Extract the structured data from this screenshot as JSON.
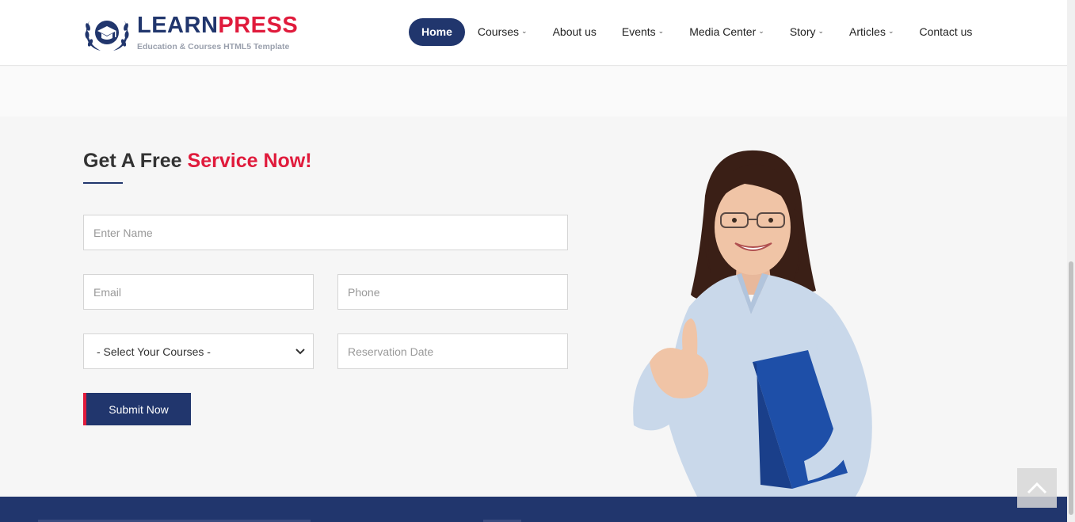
{
  "brand": {
    "name_part1": "LEARN",
    "name_part2": "PRESS",
    "tagline": "Education & Courses HTML5 Template"
  },
  "nav": {
    "items": [
      {
        "label": "Home",
        "active": true,
        "dropdown": false
      },
      {
        "label": "Courses",
        "active": false,
        "dropdown": true
      },
      {
        "label": "About us",
        "active": false,
        "dropdown": false
      },
      {
        "label": "Events",
        "active": false,
        "dropdown": true
      },
      {
        "label": "Media Center",
        "active": false,
        "dropdown": true
      },
      {
        "label": "Story",
        "active": false,
        "dropdown": true
      },
      {
        "label": "Articles",
        "active": false,
        "dropdown": true
      },
      {
        "label": "Contact us",
        "active": false,
        "dropdown": false
      }
    ]
  },
  "section": {
    "heading_part1": "Get A Free",
    "heading_accent": "Service Now!"
  },
  "form": {
    "name_placeholder": "Enter Name",
    "email_placeholder": "Email",
    "phone_placeholder": "Phone",
    "course_select_value": "- Select Your Courses -",
    "date_placeholder": "Reservation Date",
    "submit_label": "Submit Now"
  },
  "icons": {
    "logo": "graduation-cap-laurel-icon",
    "dropdown": "chevron-down-icon",
    "back_to_top": "chevron-up-icon"
  },
  "colors": {
    "primary": "#21366d",
    "accent": "#e01b3c",
    "background": "#f6f6f6"
  }
}
